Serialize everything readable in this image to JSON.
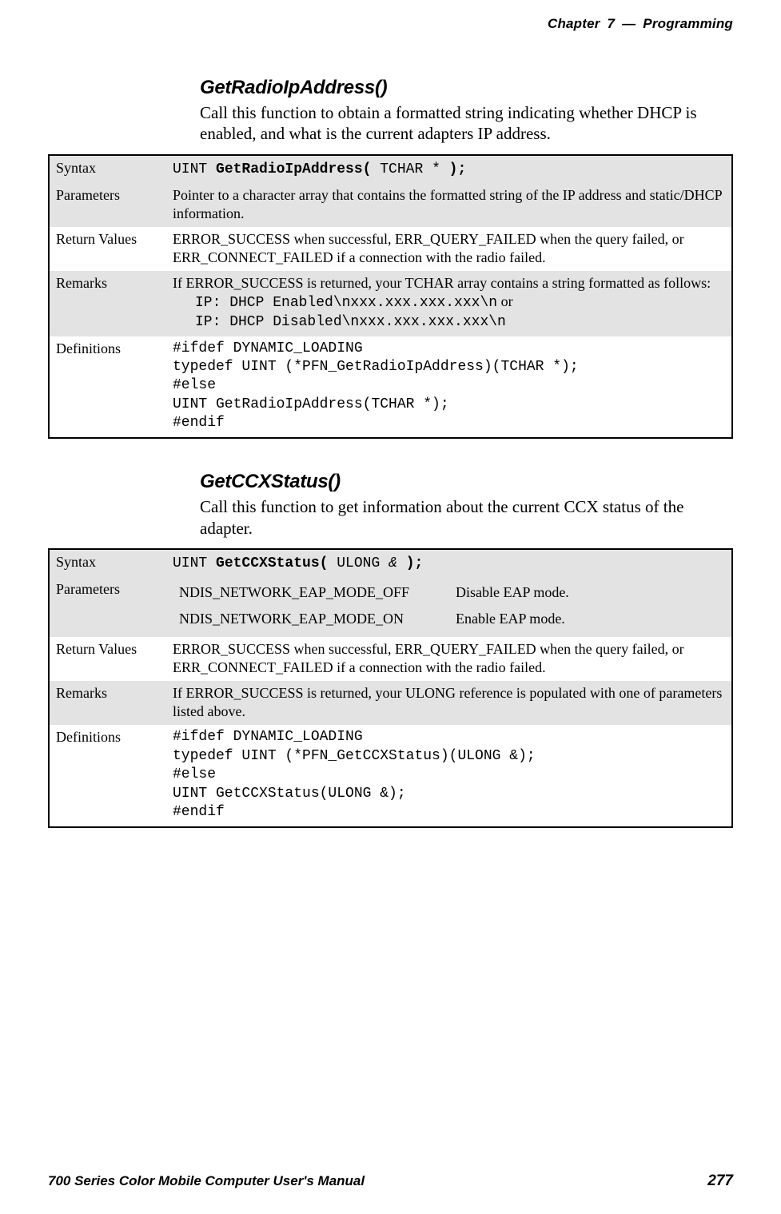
{
  "header": {
    "chapter_label": "Chapter",
    "chapter_number": "7",
    "dash": "—",
    "chapter_title": "Programming"
  },
  "section1": {
    "heading": "GetRadioIpAddress()",
    "description": "Call this function to obtain a formatted string indicating whether DHCP is enabled, and what is the current adapters IP address.",
    "rows": {
      "syntax_label": "Syntax",
      "syntax_prefix": "UINT ",
      "syntax_bold": "GetRadioIpAddress(",
      "syntax_mid": " TCHAR * ",
      "syntax_bold2": ");",
      "parameters_label": "Parameters",
      "parameters_text": "Pointer to a character array that contains the formatted string of the IP address and static/DHCP information.",
      "return_label": "Return Values",
      "return_text": "ERROR_SUCCESS when successful, ERR_QUERY_FAILED when the query failed, or ERR_CONNECT_FAILED if a connection with the radio failed.",
      "remarks_label": "Remarks",
      "remarks_intro": "If ERROR_SUCCESS is returned, your TCHAR array contains a string formatted as follows:",
      "remarks_code1": "IP: DHCP Enabled\\nxxx.xxx.xxx.xxx\\n",
      "remarks_or": " or",
      "remarks_code2": "IP: DHCP Disabled\\nxxx.xxx.xxx.xxx\\n",
      "definitions_label": "Definitions",
      "definitions_code": "#ifdef DYNAMIC_LOADING\ntypedef UINT (*PFN_GetRadioIpAddress)(TCHAR *);\n#else\nUINT GetRadioIpAddress(TCHAR *);\n#endif"
    }
  },
  "section2": {
    "heading": "GetCCXStatus()",
    "description": "Call this function to get information about the current CCX status of the adapter.",
    "rows": {
      "syntax_label": "Syntax",
      "syntax_prefix": "UINT ",
      "syntax_bold": "GetCCXStatus(",
      "syntax_mid": " ULONG ",
      "syntax_italic": "&",
      "syntax_mid2": " ",
      "syntax_bold2": ");",
      "parameters_label": "Parameters",
      "param1_name": "NDIS_NETWORK_EAP_MODE_OFF",
      "param1_desc": "Disable EAP mode.",
      "param2_name": "NDIS_NETWORK_EAP_MODE_ON",
      "param2_desc": "Enable EAP mode.",
      "return_label": "Return Values",
      "return_text": "ERROR_SUCCESS when successful, ERR_QUERY_FAILED when the query failed, or ERR_CONNECT_FAILED if a connection with the radio failed.",
      "remarks_label": "Remarks",
      "remarks_text": "If ERROR_SUCCESS is returned, your ULONG reference is populated with one of parameters listed above.",
      "definitions_label": "Definitions",
      "definitions_code": "#ifdef DYNAMIC_LOADING\ntypedef UINT (*PFN_GetCCXStatus)(ULONG &);\n#else\nUINT GetCCXStatus(ULONG &);\n#endif"
    }
  },
  "footer": {
    "manual_title": "700 Series Color Mobile Computer User's Manual",
    "page_number": "277"
  }
}
